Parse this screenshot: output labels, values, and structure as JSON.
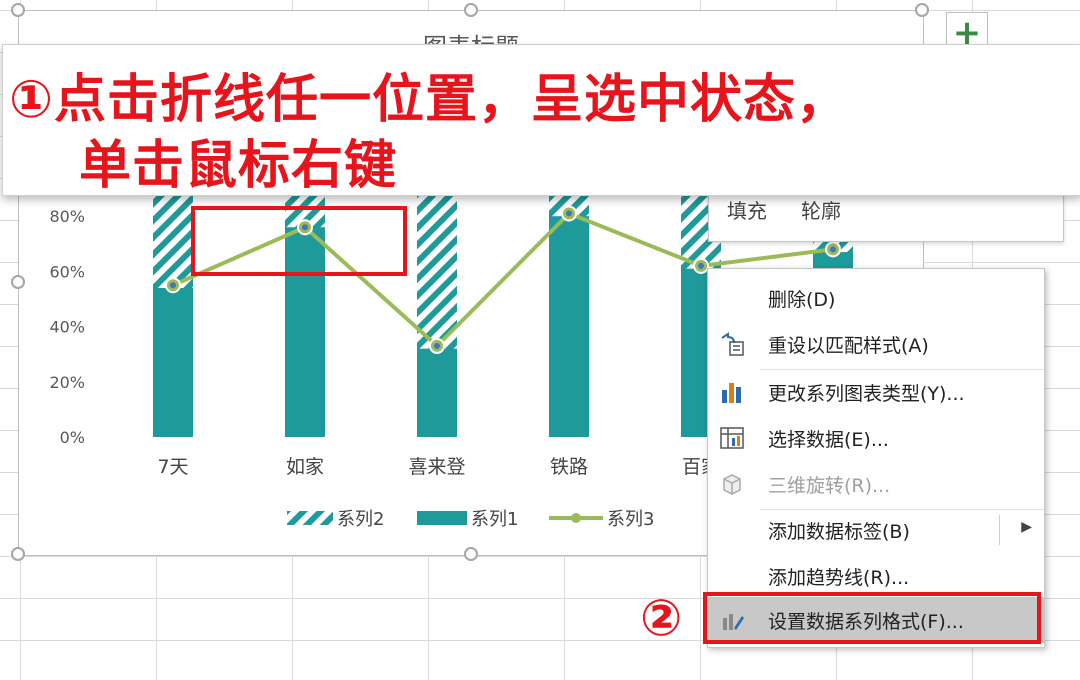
{
  "chart_data": {
    "type": "bar",
    "title": "图表标题",
    "categories": [
      "7天",
      "如家",
      "喜来登",
      "铁路",
      "百家",
      ""
    ],
    "series": [
      {
        "name": "系列2",
        "style": "hatched",
        "color": "#1f9a9a",
        "values": [
          100,
          100,
          100,
          100,
          100,
          100
        ]
      },
      {
        "name": "系列1",
        "style": "solid",
        "color": "#1f9a9a",
        "values": [
          54,
          76,
          32,
          80,
          61,
          67
        ]
      },
      {
        "name": "系列3",
        "style": "line",
        "color": "#9bbb59",
        "values": [
          55,
          76,
          33,
          81,
          62,
          68
        ]
      }
    ],
    "ylim": [
      0,
      1.0
    ],
    "yticks": [
      "0%",
      "20%",
      "40%",
      "60%",
      "80%"
    ],
    "legend_position": "bottom",
    "grid": false
  },
  "annotations": {
    "step1_line1": "①点击折线任一位置，呈选中状态，",
    "step1_line2": "单击鼠标右键",
    "step2_badge": "②"
  },
  "format_pane": {
    "fill_label": "填充",
    "outline_label": "轮廓"
  },
  "context_menu": {
    "items": [
      {
        "label": "删除(D)",
        "icon": "none",
        "enabled": true
      },
      {
        "label": "重设以匹配样式(A)",
        "icon": "reset-style-icon",
        "enabled": true
      },
      {
        "label": "更改系列图表类型(Y)...",
        "icon": "bar-chart-icon",
        "enabled": true
      },
      {
        "label": "选择数据(E)...",
        "icon": "select-data-icon",
        "enabled": true
      },
      {
        "label": "三维旋转(R)...",
        "icon": "cube-icon",
        "enabled": false
      },
      {
        "label": "添加数据标签(B)",
        "icon": "none",
        "enabled": true,
        "submenu": true
      },
      {
        "label": "添加趋势线(R)...",
        "icon": "none",
        "enabled": true
      },
      {
        "label": "设置数据系列格式(F)...",
        "icon": "format-series-icon",
        "enabled": true,
        "highlighted": true
      }
    ]
  },
  "colors": {
    "accent_red": "#e8141b",
    "teal": "#1f9a9a",
    "line_green": "#9bbb59"
  }
}
